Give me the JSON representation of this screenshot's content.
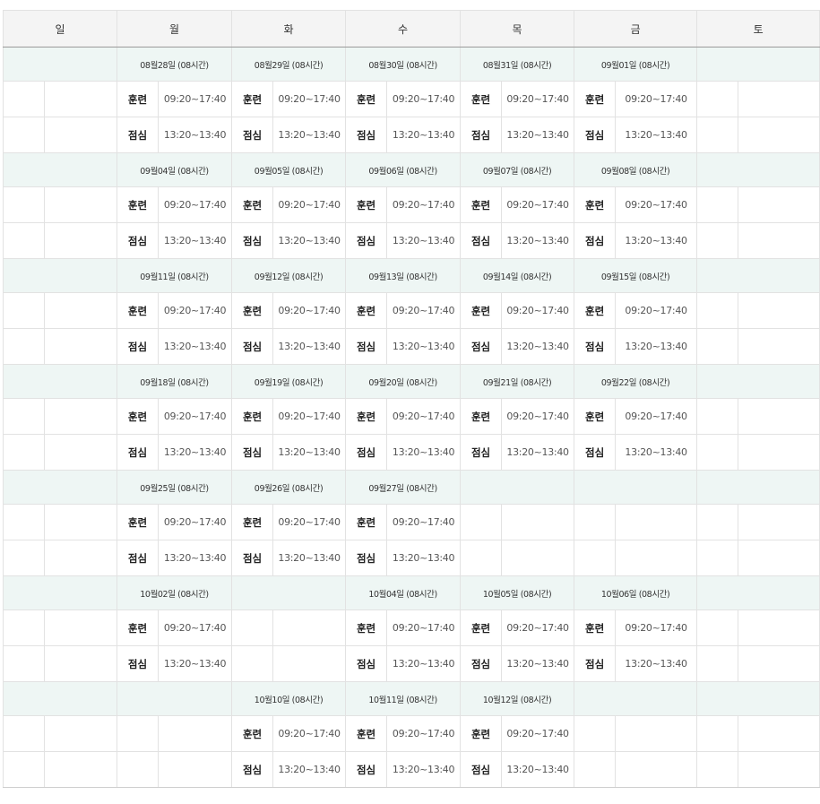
{
  "days": [
    "일",
    "월",
    "화",
    "수",
    "목",
    "금",
    "토"
  ],
  "weeks": [
    {
      "dates": [
        "",
        "08월28일 (08시간)",
        "08월29일 (08시간)",
        "08월30일 (08시간)",
        "08월31일 (08시간)",
        "09월01일 (08시간)",
        ""
      ],
      "slots": [
        [
          {
            "label": "",
            "time": ""
          },
          {
            "label": "훈련",
            "time": "09:20~17:40"
          },
          {
            "label": "훈련",
            "time": "09:20~17:40"
          },
          {
            "label": "훈련",
            "time": "09:20~17:40"
          },
          {
            "label": "훈련",
            "time": "09:20~17:40"
          },
          {
            "label": "훈련",
            "time": "09:20~17:40"
          },
          {
            "label": "",
            "time": ""
          }
        ],
        [
          {
            "label": "",
            "time": ""
          },
          {
            "label": "점심",
            "time": "13:20~13:40"
          },
          {
            "label": "점심",
            "time": "13:20~13:40"
          },
          {
            "label": "점심",
            "time": "13:20~13:40"
          },
          {
            "label": "점심",
            "time": "13:20~13:40"
          },
          {
            "label": "점심",
            "time": "13:20~13:40"
          },
          {
            "label": "",
            "time": ""
          }
        ]
      ]
    },
    {
      "dates": [
        "",
        "09월04일 (08시간)",
        "09월05일 (08시간)",
        "09월06일 (08시간)",
        "09월07일 (08시간)",
        "09월08일 (08시간)",
        ""
      ],
      "slots": [
        [
          {
            "label": "",
            "time": ""
          },
          {
            "label": "훈련",
            "time": "09:20~17:40"
          },
          {
            "label": "훈련",
            "time": "09:20~17:40"
          },
          {
            "label": "훈련",
            "time": "09:20~17:40"
          },
          {
            "label": "훈련",
            "time": "09:20~17:40"
          },
          {
            "label": "훈련",
            "time": "09:20~17:40"
          },
          {
            "label": "",
            "time": ""
          }
        ],
        [
          {
            "label": "",
            "time": ""
          },
          {
            "label": "점심",
            "time": "13:20~13:40"
          },
          {
            "label": "점심",
            "time": "13:20~13:40"
          },
          {
            "label": "점심",
            "time": "13:20~13:40"
          },
          {
            "label": "점심",
            "time": "13:20~13:40"
          },
          {
            "label": "점심",
            "time": "13:20~13:40"
          },
          {
            "label": "",
            "time": ""
          }
        ]
      ]
    },
    {
      "dates": [
        "",
        "09월11일 (08시간)",
        "09월12일 (08시간)",
        "09월13일 (08시간)",
        "09월14일 (08시간)",
        "09월15일 (08시간)",
        ""
      ],
      "slots": [
        [
          {
            "label": "",
            "time": ""
          },
          {
            "label": "훈련",
            "time": "09:20~17:40"
          },
          {
            "label": "훈련",
            "time": "09:20~17:40"
          },
          {
            "label": "훈련",
            "time": "09:20~17:40"
          },
          {
            "label": "훈련",
            "time": "09:20~17:40"
          },
          {
            "label": "훈련",
            "time": "09:20~17:40"
          },
          {
            "label": "",
            "time": ""
          }
        ],
        [
          {
            "label": "",
            "time": ""
          },
          {
            "label": "점심",
            "time": "13:20~13:40"
          },
          {
            "label": "점심",
            "time": "13:20~13:40"
          },
          {
            "label": "점심",
            "time": "13:20~13:40"
          },
          {
            "label": "점심",
            "time": "13:20~13:40"
          },
          {
            "label": "점심",
            "time": "13:20~13:40"
          },
          {
            "label": "",
            "time": ""
          }
        ]
      ]
    },
    {
      "dates": [
        "",
        "09월18일 (08시간)",
        "09월19일 (08시간)",
        "09월20일 (08시간)",
        "09월21일 (08시간)",
        "09월22일 (08시간)",
        ""
      ],
      "slots": [
        [
          {
            "label": "",
            "time": ""
          },
          {
            "label": "훈련",
            "time": "09:20~17:40"
          },
          {
            "label": "훈련",
            "time": "09:20~17:40"
          },
          {
            "label": "훈련",
            "time": "09:20~17:40"
          },
          {
            "label": "훈련",
            "time": "09:20~17:40"
          },
          {
            "label": "훈련",
            "time": "09:20~17:40"
          },
          {
            "label": "",
            "time": ""
          }
        ],
        [
          {
            "label": "",
            "time": ""
          },
          {
            "label": "점심",
            "time": "13:20~13:40"
          },
          {
            "label": "점심",
            "time": "13:20~13:40"
          },
          {
            "label": "점심",
            "time": "13:20~13:40"
          },
          {
            "label": "점심",
            "time": "13:20~13:40"
          },
          {
            "label": "점심",
            "time": "13:20~13:40"
          },
          {
            "label": "",
            "time": ""
          }
        ]
      ]
    },
    {
      "dates": [
        "",
        "09월25일 (08시간)",
        "09월26일 (08시간)",
        "09월27일 (08시간)",
        "",
        "",
        ""
      ],
      "slots": [
        [
          {
            "label": "",
            "time": ""
          },
          {
            "label": "훈련",
            "time": "09:20~17:40"
          },
          {
            "label": "훈련",
            "time": "09:20~17:40"
          },
          {
            "label": "훈련",
            "time": "09:20~17:40"
          },
          {
            "label": "",
            "time": ""
          },
          {
            "label": "",
            "time": ""
          },
          {
            "label": "",
            "time": ""
          }
        ],
        [
          {
            "label": "",
            "time": ""
          },
          {
            "label": "점심",
            "time": "13:20~13:40"
          },
          {
            "label": "점심",
            "time": "13:20~13:40"
          },
          {
            "label": "점심",
            "time": "13:20~13:40"
          },
          {
            "label": "",
            "time": ""
          },
          {
            "label": "",
            "time": ""
          },
          {
            "label": "",
            "time": ""
          }
        ]
      ]
    },
    {
      "dates": [
        "",
        "10월02일 (08시간)",
        "",
        "10월04일 (08시간)",
        "10월05일 (08시간)",
        "10월06일 (08시간)",
        ""
      ],
      "slots": [
        [
          {
            "label": "",
            "time": ""
          },
          {
            "label": "훈련",
            "time": "09:20~17:40"
          },
          {
            "label": "",
            "time": ""
          },
          {
            "label": "훈련",
            "time": "09:20~17:40"
          },
          {
            "label": "훈련",
            "time": "09:20~17:40"
          },
          {
            "label": "훈련",
            "time": "09:20~17:40"
          },
          {
            "label": "",
            "time": ""
          }
        ],
        [
          {
            "label": "",
            "time": ""
          },
          {
            "label": "점심",
            "time": "13:20~13:40"
          },
          {
            "label": "",
            "time": ""
          },
          {
            "label": "점심",
            "time": "13:20~13:40"
          },
          {
            "label": "점심",
            "time": "13:20~13:40"
          },
          {
            "label": "점심",
            "time": "13:20~13:40"
          },
          {
            "label": "",
            "time": ""
          }
        ]
      ]
    },
    {
      "dates": [
        "",
        "",
        "10월10일 (08시간)",
        "10월11일 (08시간)",
        "10월12일 (08시간)",
        "",
        ""
      ],
      "slots": [
        [
          {
            "label": "",
            "time": ""
          },
          {
            "label": "",
            "time": ""
          },
          {
            "label": "훈련",
            "time": "09:20~17:40"
          },
          {
            "label": "훈련",
            "time": "09:20~17:40"
          },
          {
            "label": "훈련",
            "time": "09:20~17:40"
          },
          {
            "label": "",
            "time": ""
          },
          {
            "label": "",
            "time": ""
          }
        ],
        [
          {
            "label": "",
            "time": ""
          },
          {
            "label": "",
            "time": ""
          },
          {
            "label": "점심",
            "time": "13:20~13:40"
          },
          {
            "label": "점심",
            "time": "13:20~13:40"
          },
          {
            "label": "점심",
            "time": "13:20~13:40"
          },
          {
            "label": "",
            "time": ""
          },
          {
            "label": "",
            "time": ""
          }
        ]
      ]
    }
  ]
}
